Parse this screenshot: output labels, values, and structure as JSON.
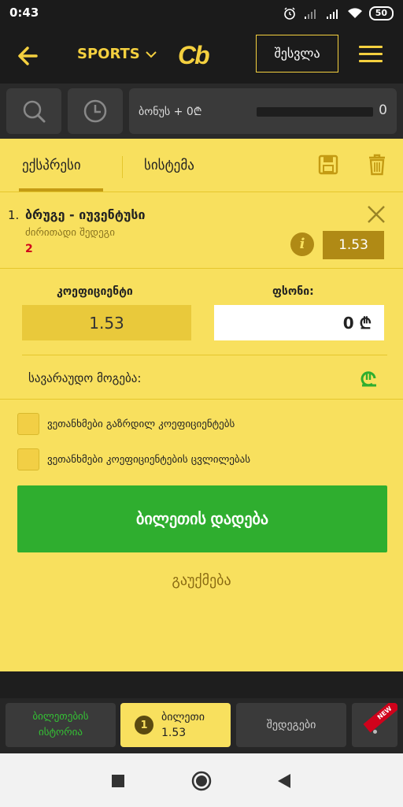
{
  "status_bar": {
    "time": "0:43",
    "battery": "50"
  },
  "header": {
    "sports_label": "SPORTS",
    "logo_text": "Cb",
    "login_label": "შესვლა"
  },
  "toolbar": {
    "bonus_label": "ბონუს + 0₾",
    "bonus_count": "0"
  },
  "betslip": {
    "tabs": [
      {
        "label": "ექსპრესი",
        "active": true
      },
      {
        "label": "სისტემა",
        "active": false
      }
    ],
    "bet": {
      "index": "1.",
      "match": "ბრუგე - იუვენტუსი",
      "market": "ძირითადი შედეგი",
      "outcome": "2",
      "odds": "1.53"
    },
    "coefficient_label": "კოეფიციენტი",
    "coefficient_value": "1.53",
    "stake_label": "ფსონი:",
    "stake_value": "0 ₾",
    "potential_win_label": "სავარაუდო მოგება:",
    "checkbox_increase": "ვეთანხმები გაზრდილ კოეფიციენტებს",
    "checkbox_change": "ვეთანხმები კოეფიციენტების ცვლილებას",
    "place_bet_label": "ბილეთის დადება",
    "cancel_label": "გაუქმება"
  },
  "bottom_tabs": {
    "history_label": "ბილეთების ისტორია",
    "ticket_count": "1",
    "ticket_label": "ბილეთი",
    "ticket_odds": "1.53",
    "results_label": "შედეგები",
    "new_badge": "NEW"
  },
  "colors": {
    "accent_yellow": "#f4d03f",
    "panel_yellow": "#f8e05e",
    "green": "#2fae2f",
    "red": "#d0021b"
  }
}
